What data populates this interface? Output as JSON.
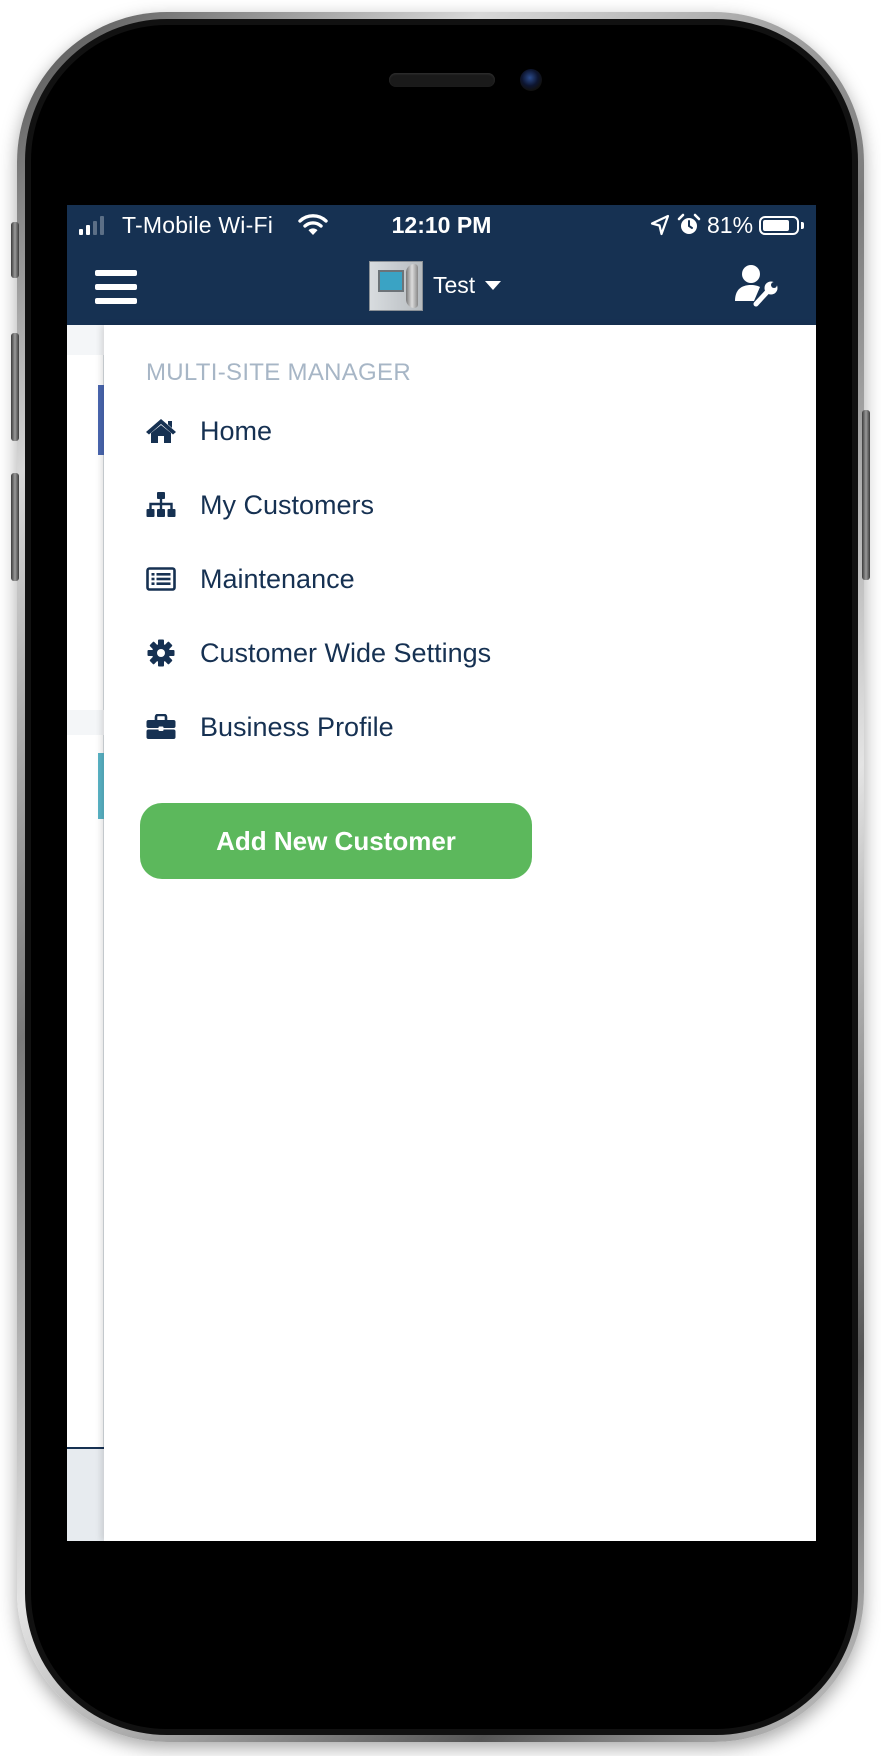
{
  "status_bar": {
    "carrier": "T-Mobile Wi-Fi",
    "time": "12:10 PM",
    "battery": "81%",
    "battery_level": 0.81,
    "icons": [
      "signal-icon",
      "wifi-icon",
      "location-arrow-icon",
      "alarm-clock-icon",
      "battery-icon"
    ]
  },
  "header": {
    "site_name": "Test",
    "left_icon": "hamburger-menu-icon",
    "selector_icon": "caret-down-icon",
    "right_icon": "user-wrench-icon"
  },
  "drawer": {
    "section_title": "MULTI-SITE MANAGER",
    "items": [
      {
        "label": "Home",
        "icon": "home-icon"
      },
      {
        "label": "My Customers",
        "icon": "sitemap-icon"
      },
      {
        "label": "Maintenance",
        "icon": "list-alt-icon"
      },
      {
        "label": "Customer Wide Settings",
        "icon": "gear-icon"
      },
      {
        "label": "Business Profile",
        "icon": "briefcase-icon"
      }
    ],
    "add_button": "Add New Customer"
  },
  "colors": {
    "header_bg": "#163152",
    "menu_text": "#163152",
    "section_title": "#a7b6c6",
    "add_button": "#5cb85c"
  }
}
